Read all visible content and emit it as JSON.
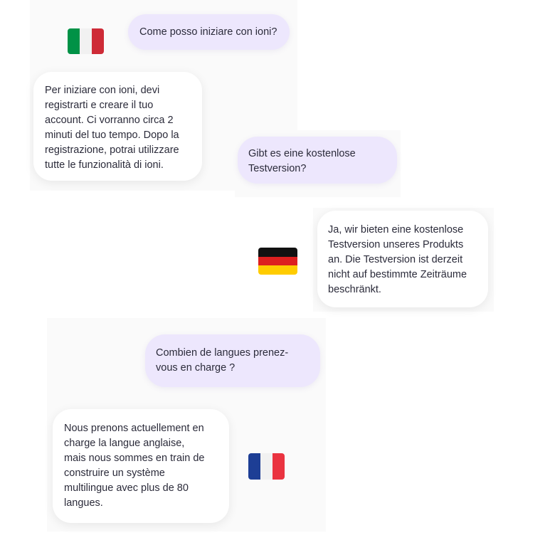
{
  "conversations": [
    {
      "language": "Italian",
      "flag": {
        "icon": "italy-flag-icon",
        "colors": [
          "#009246",
          "#f1f1f1",
          "#ce2b37"
        ]
      },
      "question": "Come posso iniziare con ioni?",
      "answer": "Per iniziare con ioni, devi\nregistrarti e creare il tuo\naccount. Ci vorranno circa 2\nminuti del tuo tempo. Dopo la\nregistrazione, potrai utilizzare\ntutte le funzionalità di ioni."
    },
    {
      "language": "German",
      "flag": {
        "icon": "germany-flag-icon",
        "colors": [
          "#111111",
          "#dd1f1f",
          "#ffcc00"
        ]
      },
      "question": "Gibt es eine kostenlose\nTestversion?",
      "answer": "Ja, wir bieten eine kostenlose\nTestversion unseres Produkts\nan. Die Testversion ist derzeit\nnicht auf bestimmte Zeiträume\nbeschränkt."
    },
    {
      "language": "French",
      "flag": {
        "icon": "france-flag-icon",
        "colors": [
          "#1d3e95",
          "#f1f1f1",
          "#ea3340"
        ]
      },
      "question": "Combien de langues prenez-\nvous en charge ?",
      "answer": "Nous prenons actuellement en\ncharge la langue anglaise,\nmais nous sommes en train de\nconstruire un système\nmultilingue avec plus de 80\nlangues."
    }
  ],
  "colors": {
    "user_bubble": "#ede7fd",
    "bot_bubble": "#ffffff",
    "panel_background": "#fafafa",
    "text": "#2b2b3a"
  }
}
